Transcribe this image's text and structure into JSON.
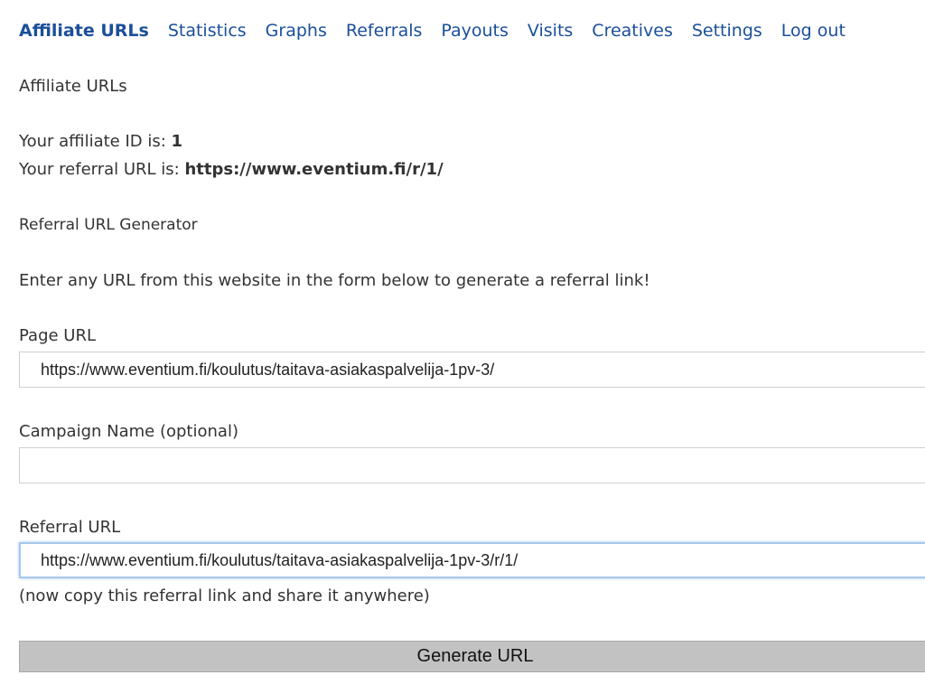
{
  "nav": {
    "items": [
      {
        "label": "Affiliate URLs",
        "active": true
      },
      {
        "label": "Statistics"
      },
      {
        "label": "Graphs"
      },
      {
        "label": "Referrals"
      },
      {
        "label": "Payouts"
      },
      {
        "label": "Visits"
      },
      {
        "label": "Creatives"
      },
      {
        "label": "Settings"
      },
      {
        "label": "Log out"
      }
    ]
  },
  "page": {
    "title": "Affiliate URLs",
    "affiliate_id_label": "Your affiliate ID is: ",
    "affiliate_id_value": "1",
    "referral_url_label": "Your referral URL is: ",
    "referral_url_value": "https://www.eventium.fi/r/1/"
  },
  "generator": {
    "heading": "Referral URL Generator",
    "instructions": "Enter any URL from this website in the form below to generate a referral link!",
    "page_url_label": "Page URL",
    "page_url_value": "https://www.eventium.fi/koulutus/taitava-asiakaspalvelija-1pv-3/",
    "campaign_label": "Campaign Name (optional)",
    "campaign_value": "",
    "referral_url_label": "Referral URL",
    "referral_url_value": "https://www.eventium.fi/koulutus/taitava-asiakaspalvelija-1pv-3/r/1/",
    "copy_hint": "(now copy this referral link and share it anywhere)",
    "generate_button": "Generate URL"
  },
  "colors": {
    "link": "#1b4f9a",
    "text": "#333333",
    "button_bg": "#c2c2c2",
    "focus_ring": "#a8c8ec"
  }
}
